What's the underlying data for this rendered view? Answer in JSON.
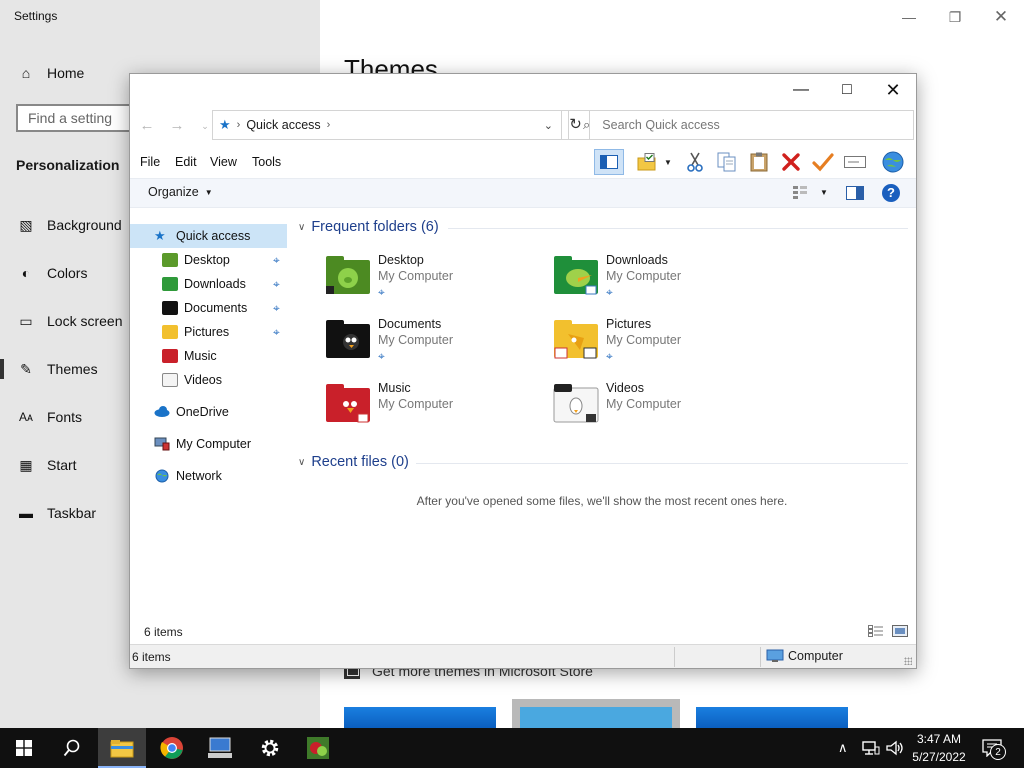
{
  "settings": {
    "title": "Settings",
    "home": "Home",
    "search_placeholder": "Find a setting",
    "section": "Personalization",
    "nav": [
      "Background",
      "Colors",
      "Lock screen",
      "Themes",
      "Fonts",
      "Start",
      "Taskbar"
    ],
    "heading": "Themes",
    "store_link": "Get more themes in Microsoft Store"
  },
  "explorer": {
    "address_path": "Quick access",
    "search_placeholder": "Search Quick access",
    "menu": [
      "File",
      "Edit",
      "View",
      "Tools"
    ],
    "organize": "Organize",
    "tree": {
      "quick_access": "Quick access",
      "items": [
        "Desktop",
        "Downloads",
        "Documents",
        "Pictures",
        "Music",
        "Videos"
      ],
      "onedrive": "OneDrive",
      "computer": "My Computer",
      "network": "Network"
    },
    "frequent_header": "Frequent folders (6)",
    "folders": [
      {
        "name": "Desktop",
        "location": "My Computer"
      },
      {
        "name": "Downloads",
        "location": "My Computer"
      },
      {
        "name": "Documents",
        "location": "My Computer"
      },
      {
        "name": "Pictures",
        "location": "My Computer"
      },
      {
        "name": "Music",
        "location": "My Computer"
      },
      {
        "name": "Videos",
        "location": "My Computer"
      }
    ],
    "recent_header": "Recent files (0)",
    "recent_empty": "After you've opened some files, we'll show the most recent ones here.",
    "item_count": "6 items",
    "status_count": "6 items",
    "status_zone": "Computer"
  },
  "taskbar": {
    "time": "3:47 AM",
    "date": "5/27/2022",
    "notification_count": "2"
  },
  "colors": {
    "accent": "#0078d7",
    "group_header": "#1e3f8c",
    "delete_red": "#d0201d",
    "check_orange": "#e67e22"
  }
}
